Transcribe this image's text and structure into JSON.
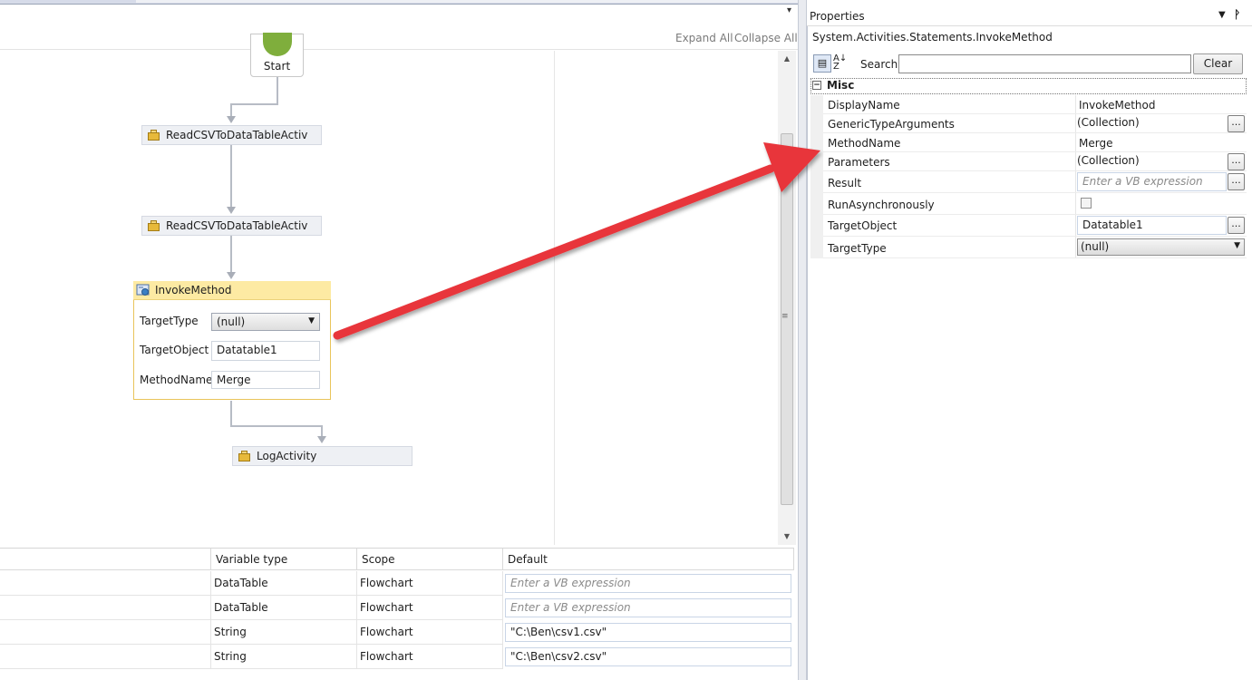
{
  "designer": {
    "expand_all": "Expand All",
    "collapse_all": "Collapse All",
    "start_label": "Start",
    "activities": [
      {
        "label": "ReadCSVToDataTableActiv"
      },
      {
        "label": "ReadCSVToDataTableActiv"
      },
      {
        "label": "LogActivity"
      }
    ],
    "invoke": {
      "title": "InvokeMethod",
      "target_type_label": "TargetType",
      "target_type_value": "(null)",
      "target_object_label": "TargetObject",
      "target_object_value": "Datatable1",
      "method_name_label": "MethodName",
      "method_name_value": "Merge"
    }
  },
  "variables": {
    "columns": [
      "Variable type",
      "Scope",
      "Default"
    ],
    "rows": [
      {
        "type": "DataTable",
        "scope": "Flowchart",
        "default": "",
        "placeholder": "Enter a VB expression"
      },
      {
        "type": "DataTable",
        "scope": "Flowchart",
        "default": "",
        "placeholder": "Enter a VB expression"
      },
      {
        "type": "String",
        "scope": "Flowchart",
        "default": "\"C:\\Ben\\csv1.csv\"",
        "placeholder": ""
      },
      {
        "type": "String",
        "scope": "Flowchart",
        "default": "\"C:\\Ben\\csv2.csv\"",
        "placeholder": ""
      }
    ]
  },
  "properties": {
    "title": "Properties",
    "type_name": "System.Activities.Statements.InvokeMethod",
    "search_label": "Search:",
    "search_value": "",
    "clear_label": "Clear",
    "category": "Misc",
    "display_name_label": "DisplayName",
    "display_name_value": "InvokeMethod",
    "generic_label": "GenericTypeArguments",
    "generic_value": "(Collection)",
    "method_name_label": "MethodName",
    "method_name_value": "Merge",
    "parameters_label": "Parameters",
    "parameters_value": "(Collection)",
    "result_label": "Result",
    "result_placeholder": "Enter a VB expression",
    "run_async_label": "RunAsynchronously",
    "target_object_label": "TargetObject",
    "target_object_value": "Datatable1",
    "target_type_label": "TargetType",
    "target_type_value": "(null)"
  },
  "colors": {
    "arrow": "#e8343a",
    "invoke_header": "#fdeaa3",
    "start_green": "#7fae3c"
  }
}
